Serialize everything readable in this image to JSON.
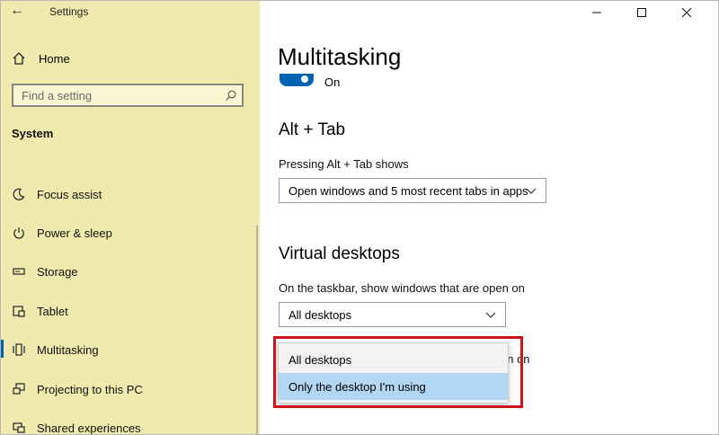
{
  "app": {
    "title": "Settings"
  },
  "sidebar": {
    "home_label": "Home",
    "search_placeholder": "Find a setting",
    "section_label": "System",
    "items": [
      {
        "label": "Focus assist",
        "icon": "moon-icon"
      },
      {
        "label": "Power & sleep",
        "icon": "power-icon"
      },
      {
        "label": "Storage",
        "icon": "storage-icon"
      },
      {
        "label": "Tablet",
        "icon": "tablet-icon"
      },
      {
        "label": "Multitasking",
        "icon": "multitasking-icon",
        "active": true
      },
      {
        "label": "Projecting to this PC",
        "icon": "projecting-icon"
      },
      {
        "label": "Shared experiences",
        "icon": "shared-experiences-icon"
      }
    ]
  },
  "main": {
    "title": "Multitasking",
    "toggle_label": "On",
    "alt_tab": {
      "heading": "Alt + Tab",
      "description": "Pressing Alt + Tab shows",
      "selected": "Open windows and 5 most recent tabs in apps"
    },
    "virtual_desktops": {
      "heading": "Virtual desktops",
      "description": "On the taskbar, show windows that are open on",
      "selected": "All desktops",
      "hidden_text": "en on",
      "options": [
        "All desktops",
        "Only the desktop I'm using"
      ],
      "highlighted_option": "Only the desktop I'm using"
    }
  },
  "colors": {
    "accent": "#0063b1",
    "sidebar_bg": "#f1eaae",
    "highlight_border": "#d0121b",
    "selected_option": "#b3d7f3"
  }
}
